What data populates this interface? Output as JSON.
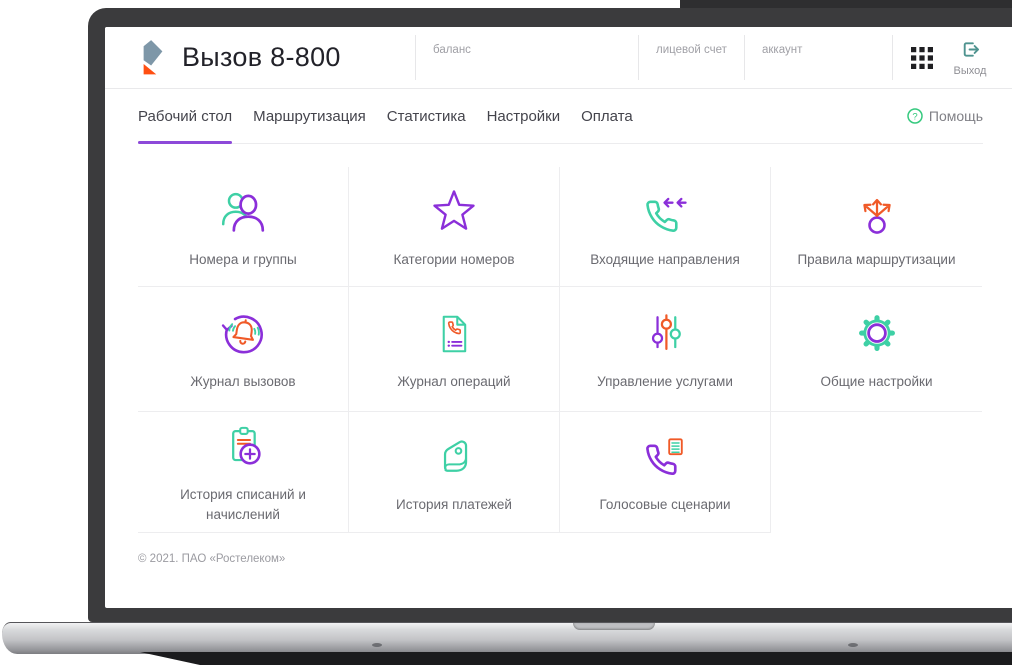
{
  "header": {
    "app_title": "Вызов 8-800",
    "account_fields": [
      {
        "label": "баланс"
      },
      {
        "label": "лицевой счет"
      },
      {
        "label": "аккаунт"
      }
    ],
    "logout_label": "Выход"
  },
  "nav": {
    "tabs": [
      {
        "label": "Рабочий стол",
        "active": true
      },
      {
        "label": "Маршрутизация",
        "active": false
      },
      {
        "label": "Статистика",
        "active": false
      },
      {
        "label": "Настройки",
        "active": false
      },
      {
        "label": "Оплата",
        "active": false
      }
    ],
    "help_label": "Помощь"
  },
  "tiles": [
    {
      "label": "Номера и группы",
      "icon": "users-icon"
    },
    {
      "label": "Категории номеров",
      "icon": "star-icon"
    },
    {
      "label": "Входящие направления",
      "icon": "incoming-call-icon"
    },
    {
      "label": "Правила маршрутизации",
      "icon": "routing-arrows-icon"
    },
    {
      "label": "Журнал вызовов",
      "icon": "call-log-icon"
    },
    {
      "label": "Журнал операций",
      "icon": "operations-log-icon"
    },
    {
      "label": "Управление услугами",
      "icon": "sliders-icon"
    },
    {
      "label": "Общие настройки",
      "icon": "gear-icon"
    },
    {
      "label": "История списаний и начислений",
      "icon": "charges-history-icon"
    },
    {
      "label": "История платежей",
      "icon": "wallet-icon"
    },
    {
      "label": "Голосовые сценарии",
      "icon": "voice-scenarios-icon"
    }
  ],
  "footer": {
    "copyright": "© 2021. ПАО «Ростелеком»"
  },
  "colors": {
    "teal": "#3ed0a5",
    "purple": "#8b2fd9",
    "orange": "#f05a28",
    "tab_underline": "#8d49d9",
    "help_green": "#35c97e",
    "logo_slate": "#7e97a8",
    "logo_orange": "#ff4f12",
    "bezel_dark": "#3b3b3d"
  }
}
